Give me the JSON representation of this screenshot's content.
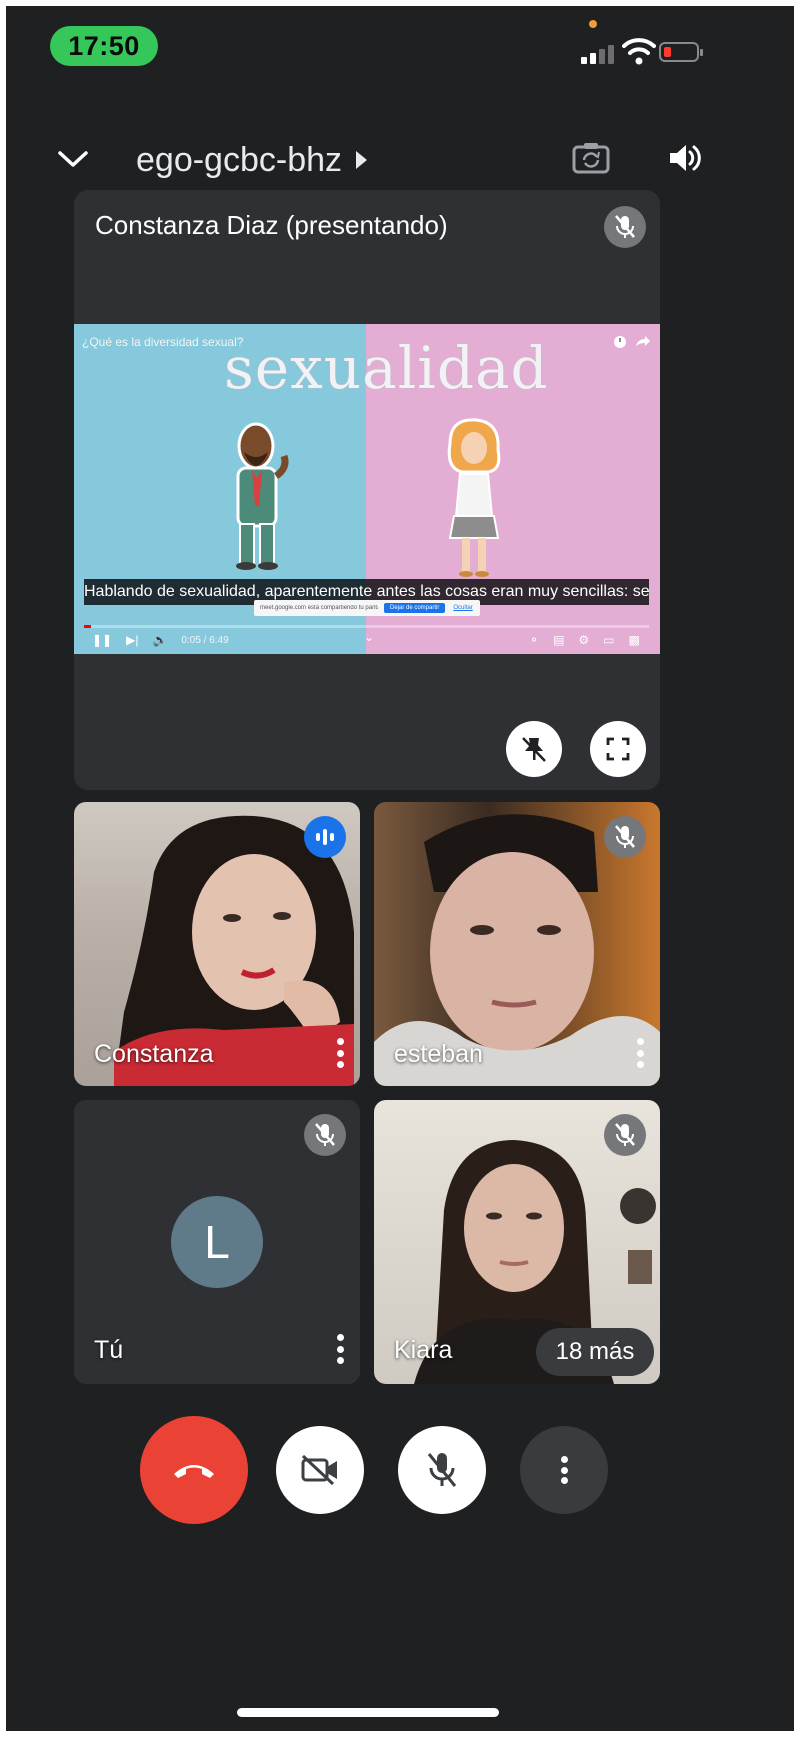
{
  "status_bar": {
    "time": "17:50"
  },
  "header": {
    "meeting_code": "ego-gcbc-bhz",
    "icons": [
      "chevron-down-icon",
      "play-arrow-icon",
      "camera-switch-icon",
      "speaker-icon"
    ]
  },
  "presentation": {
    "title": "Constanza Diaz (presentando)",
    "video": {
      "title": "¿Qué es la diversidad sexual?",
      "heading_word": "sexualidad",
      "subtitle": "Hablando de sexualidad, aparentemente antes las cosas eran muy sencillas: según",
      "share_notice": "meet.google.com está compartiendo tu pantalla.",
      "share_stop_label": "Dejar de compartir",
      "share_hide_label": "Ocultar",
      "time": "0:05 / 6:49",
      "progress_fraction": 0.013
    }
  },
  "participants": [
    {
      "name": "Constanza",
      "state": "speaking"
    },
    {
      "name": "esteban",
      "state": "muted"
    },
    {
      "name": "Tú",
      "state": "muted",
      "avatar_letter": "L"
    },
    {
      "name": "Kiara",
      "state": "muted"
    }
  ],
  "overflow": {
    "label": "18 más"
  },
  "colors": {
    "background": "#1f2022",
    "tile": "#2f3034",
    "end_call": "#ea4335",
    "accent": "#1a73e8",
    "avatar": "#5f7b89"
  }
}
